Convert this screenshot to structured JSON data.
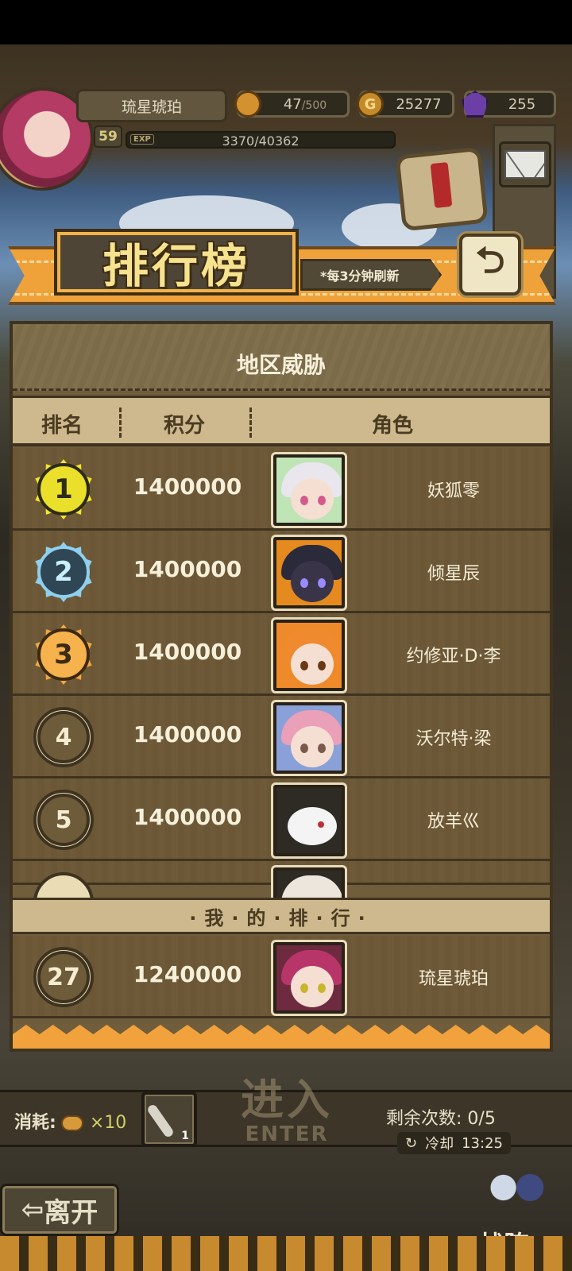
{
  "player": {
    "name": "琉星琥珀",
    "level": "59",
    "exp_tag": "EXP",
    "exp": "3370/40362"
  },
  "resources": {
    "stamina": "47",
    "stamina_max": "/500",
    "gold_icon": "G",
    "gold": "25277",
    "gems": "255"
  },
  "banner": {
    "title": "排行榜",
    "note": "*每3分钟刷新"
  },
  "panel": {
    "title": "地区威胁",
    "columns": {
      "rank": "排名",
      "score": "积分",
      "character": "角色"
    },
    "rows": [
      {
        "rank": "1",
        "score": "1400000",
        "name": "妖狐零"
      },
      {
        "rank": "2",
        "score": "1400000",
        "name": "倾星辰"
      },
      {
        "rank": "3",
        "score": "1400000",
        "name": "约修亚·D·李"
      },
      {
        "rank": "4",
        "score": "1400000",
        "name": "沃尔特·梁"
      },
      {
        "rank": "5",
        "score": "1400000",
        "name": "放羊巛"
      }
    ],
    "my_rank_label": "·我·的·排·行·",
    "my_rank": {
      "rank": "27",
      "score": "1240000",
      "name": "琉星琥珀"
    }
  },
  "bottom": {
    "consume_label": "消耗:",
    "consume_times": "×10",
    "item_count": "1",
    "enter_cn": "进入",
    "enter_en": "ENTER",
    "remaining": "剩余次数: 0/5",
    "cooldown_label": "冷却",
    "cooldown_time": "13:25",
    "leave": "离开",
    "lineup": "战阵"
  },
  "icons": {
    "back": "return-icon",
    "mail": "mail-icon",
    "quest": "quest-scroll-icon",
    "stamina": "bread-icon",
    "gold": "gold-coin-icon",
    "gem": "purple-gem-icon"
  },
  "colors": {
    "accent_orange": "#f0a23a",
    "panel_brown": "#6f5d3c",
    "header_tan": "#cdb98d",
    "gold_medal": "#f3e52a",
    "silver_medal": "#8fd0ee",
    "bronze_medal": "#f2a73f"
  }
}
